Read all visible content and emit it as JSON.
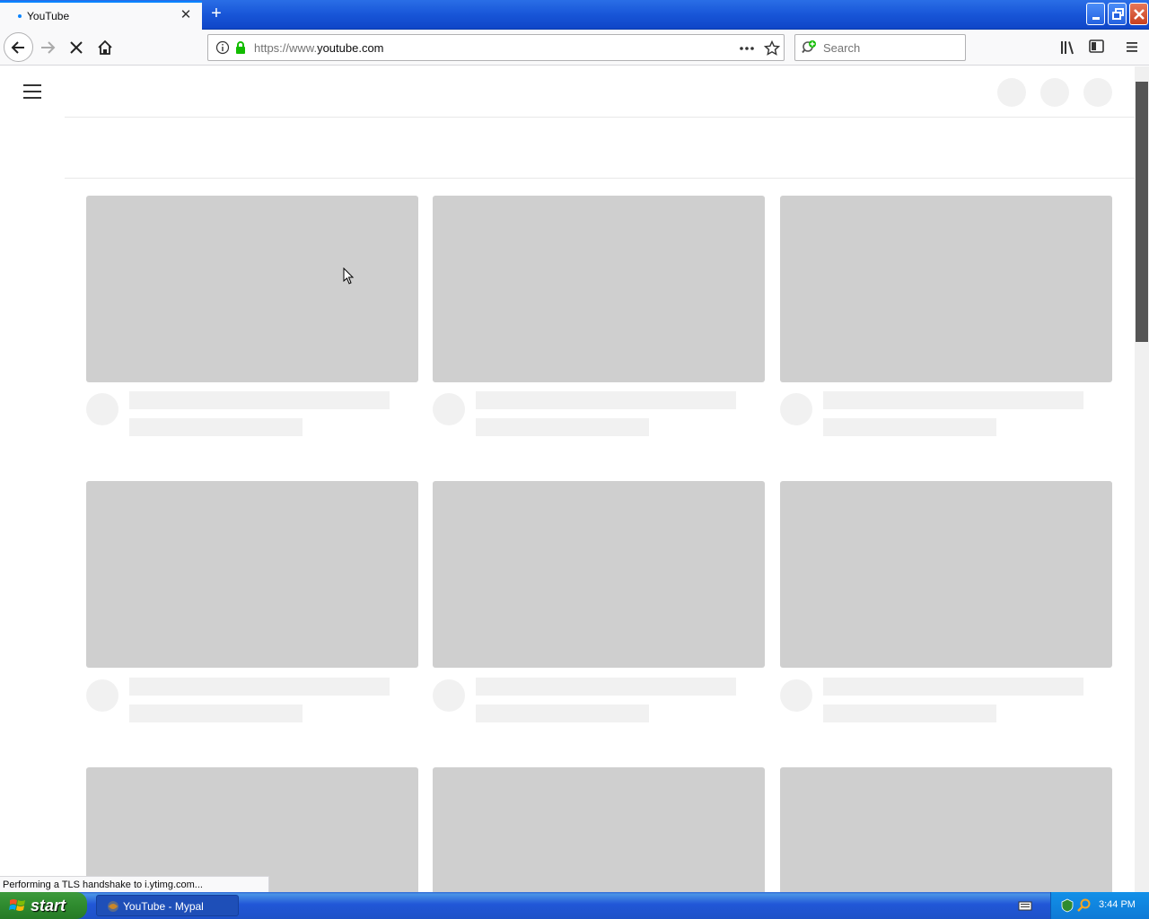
{
  "browser": {
    "tab_title": "YouTube",
    "url_prefix": "https://www.",
    "url_domain": "youtube.com",
    "search_placeholder": "Search",
    "status_text": "Performing a TLS handshake to i.ytimg.com..."
  },
  "taskbar": {
    "start_label": "start",
    "task_label": "YouTube - Mypal",
    "clock": "3:44 PM"
  },
  "icons": {
    "back": "back-arrow-icon",
    "forward": "forward-arrow-icon",
    "stop": "stop-icon",
    "home": "home-icon",
    "info": "info-icon",
    "lock": "lock-icon",
    "page_actions": "more-dots-icon",
    "bookmark": "star-icon",
    "library": "library-icon",
    "sidebar": "sidebar-icon",
    "menu": "hamburger-icon"
  },
  "colors": {
    "skeleton_thumb": "#cfcfcf",
    "skeleton_text": "#f1f1f1",
    "accent": "#0a84ff",
    "lock_green": "#12bc00"
  }
}
